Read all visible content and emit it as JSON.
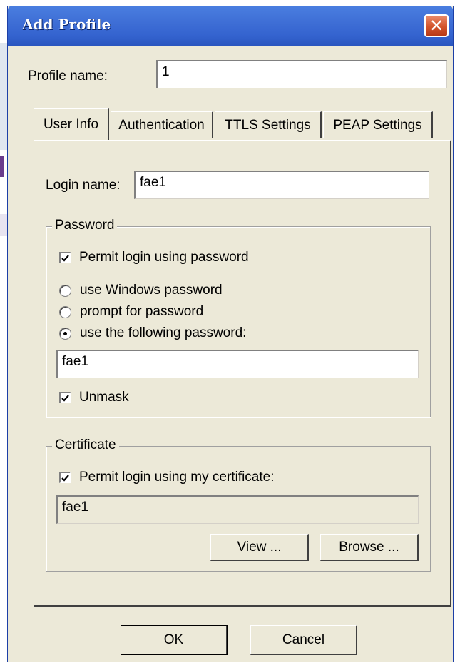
{
  "window": {
    "title": "Add Profile",
    "close_glyph": "✕"
  },
  "profile": {
    "label": "Profile name:",
    "value": "1"
  },
  "tabs": [
    {
      "label": "User Info",
      "active": true
    },
    {
      "label": "Authentication",
      "active": false
    },
    {
      "label": "TTLS Settings",
      "active": false
    },
    {
      "label": "PEAP Settings",
      "active": false
    }
  ],
  "user_info": {
    "login_label": "Login name:",
    "login_value": "fae1",
    "password_group": {
      "title": "Password",
      "permit_label": "Permit login using password",
      "permit_checked": true,
      "radio_windows": "use Windows password",
      "radio_prompt": "prompt for password",
      "radio_following": "use the following password:",
      "selected": "following",
      "password_value": "fae1",
      "unmask_label": "Unmask",
      "unmask_checked": true
    },
    "certificate_group": {
      "title": "Certificate",
      "permit_label": "Permit login using my certificate:",
      "permit_checked": true,
      "certificate_value": "fae1",
      "view_label": "View ...",
      "browse_label": "Browse ..."
    }
  },
  "footer": {
    "ok_label": "OK",
    "cancel_label": "Cancel"
  }
}
